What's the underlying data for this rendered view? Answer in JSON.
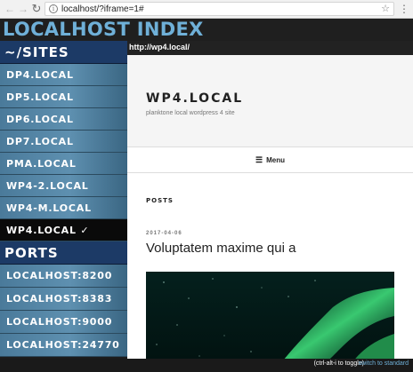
{
  "browser": {
    "url": "localhost/?iframe=1#",
    "back_icon": "arrow-left",
    "forward_icon": "arrow-right",
    "reload_icon": "reload",
    "info_icon": "info",
    "star_icon": "star",
    "menu_icon": "vertical-dots"
  },
  "header": {
    "title": "LOCALHOST INDEX"
  },
  "sidebar": {
    "sites_heading": "~/SITES",
    "sites": [
      {
        "label": "DP4.LOCAL",
        "active": false
      },
      {
        "label": "DP5.LOCAL",
        "active": false
      },
      {
        "label": "DP6.LOCAL",
        "active": false
      },
      {
        "label": "DP7.LOCAL",
        "active": false
      },
      {
        "label": "PMA.LOCAL",
        "active": false
      },
      {
        "label": "WP4-2.LOCAL",
        "active": false
      },
      {
        "label": "WP4-M.LOCAL",
        "active": false
      },
      {
        "label": "WP4.LOCAL ✓",
        "active": true
      }
    ],
    "ports_heading": "PORTS",
    "ports": [
      {
        "label": "LOCALHOST:8200"
      },
      {
        "label": "LOCALHOST:8383"
      },
      {
        "label": "LOCALHOST:9000"
      },
      {
        "label": "LOCALHOST:24770"
      }
    ]
  },
  "frame": {
    "url": "http://wp4.local/",
    "site_title": "WP4.LOCAL",
    "site_description": "planktone local wordpress 4 site",
    "menu_label": "Menu",
    "posts_heading": "POSTS",
    "post": {
      "date": "2017-04-06",
      "title": "Voluptatem maxime qui a"
    }
  },
  "footer": {
    "note": "(ctrl-alt-i to toggle)",
    "link": "switch to standard"
  },
  "colors": {
    "accent": "#6fb0d8",
    "section_heading": "#1c3a66",
    "active_item": "#0a0a0a"
  }
}
